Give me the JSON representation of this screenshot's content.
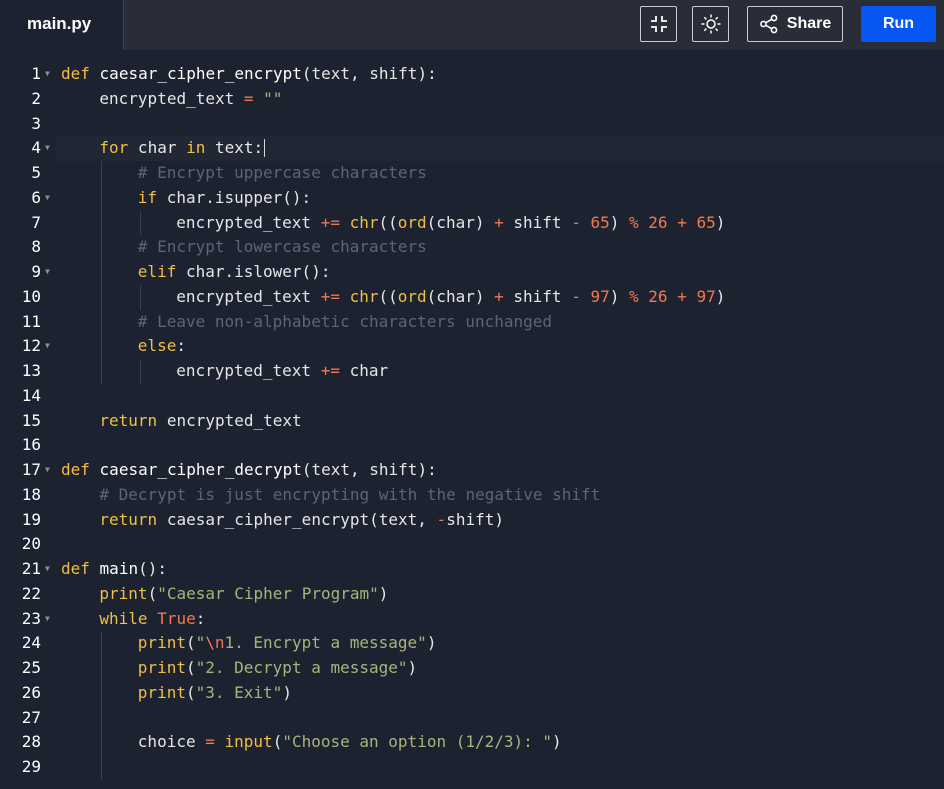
{
  "tab": {
    "filename": "main.py"
  },
  "toolbar": {
    "share_label": "Share",
    "run_label": "Run",
    "accent_color": "#0556f3",
    "buttons": [
      "compress-icon",
      "theme-sun-icon",
      "share-icon"
    ]
  },
  "editor": {
    "active_line": 4,
    "lines": [
      {
        "n": "1",
        "fold": true,
        "indent": 0,
        "tokens": [
          [
            "kw",
            "def"
          ],
          [
            "p",
            " "
          ],
          [
            "fn",
            "caesar_cipher_encrypt"
          ],
          [
            "p",
            "(text, shift):"
          ]
        ]
      },
      {
        "n": "2",
        "fold": false,
        "indent": 1,
        "tokens": [
          [
            "p",
            "encrypted_text "
          ],
          [
            "op",
            "="
          ],
          [
            "p",
            " "
          ],
          [
            "str",
            "\"\""
          ]
        ]
      },
      {
        "n": "3",
        "fold": false,
        "indent": 0,
        "tokens": []
      },
      {
        "n": "4",
        "fold": true,
        "indent": 1,
        "tokens": [
          [
            "kw",
            "for"
          ],
          [
            "p",
            " char "
          ],
          [
            "kw",
            "in"
          ],
          [
            "p",
            " text:"
          ]
        ]
      },
      {
        "n": "5",
        "fold": false,
        "indent": 2,
        "tokens": [
          [
            "cm",
            "# Encrypt uppercase characters"
          ]
        ]
      },
      {
        "n": "6",
        "fold": true,
        "indent": 2,
        "tokens": [
          [
            "kw",
            "if"
          ],
          [
            "p",
            " char.isupper():"
          ]
        ]
      },
      {
        "n": "7",
        "fold": false,
        "indent": 3,
        "tokens": [
          [
            "p",
            "encrypted_text "
          ],
          [
            "op",
            "+="
          ],
          [
            "p",
            " "
          ],
          [
            "bi",
            "chr"
          ],
          [
            "p",
            "(("
          ],
          [
            "bi",
            "ord"
          ],
          [
            "p",
            "(char) "
          ],
          [
            "op",
            "+"
          ],
          [
            "p",
            " shift "
          ],
          [
            "op",
            "-"
          ],
          [
            "p",
            " "
          ],
          [
            "num",
            "65"
          ],
          [
            "p",
            ") "
          ],
          [
            "op",
            "%"
          ],
          [
            "p",
            " "
          ],
          [
            "num",
            "26"
          ],
          [
            "p",
            " "
          ],
          [
            "op",
            "+"
          ],
          [
            "p",
            " "
          ],
          [
            "num",
            "65"
          ],
          [
            "p",
            ")"
          ]
        ]
      },
      {
        "n": "8",
        "fold": false,
        "indent": 2,
        "tokens": [
          [
            "cm",
            "# Encrypt lowercase characters"
          ]
        ]
      },
      {
        "n": "9",
        "fold": true,
        "indent": 2,
        "tokens": [
          [
            "kw",
            "elif"
          ],
          [
            "p",
            " char.islower():"
          ]
        ]
      },
      {
        "n": "10",
        "fold": false,
        "indent": 3,
        "tokens": [
          [
            "p",
            "encrypted_text "
          ],
          [
            "op",
            "+="
          ],
          [
            "p",
            " "
          ],
          [
            "bi",
            "chr"
          ],
          [
            "p",
            "(("
          ],
          [
            "bi",
            "ord"
          ],
          [
            "p",
            "(char) "
          ],
          [
            "op",
            "+"
          ],
          [
            "p",
            " shift "
          ],
          [
            "op",
            "-"
          ],
          [
            "p",
            " "
          ],
          [
            "num",
            "97"
          ],
          [
            "p",
            ") "
          ],
          [
            "op",
            "%"
          ],
          [
            "p",
            " "
          ],
          [
            "num",
            "26"
          ],
          [
            "p",
            " "
          ],
          [
            "op",
            "+"
          ],
          [
            "p",
            " "
          ],
          [
            "num",
            "97"
          ],
          [
            "p",
            ")"
          ]
        ]
      },
      {
        "n": "11",
        "fold": false,
        "indent": 2,
        "tokens": [
          [
            "cm",
            "# Leave non-alphabetic characters unchanged"
          ]
        ]
      },
      {
        "n": "12",
        "fold": true,
        "indent": 2,
        "tokens": [
          [
            "kw",
            "else"
          ],
          [
            "p",
            ":"
          ]
        ]
      },
      {
        "n": "13",
        "fold": false,
        "indent": 3,
        "tokens": [
          [
            "p",
            "encrypted_text "
          ],
          [
            "op",
            "+="
          ],
          [
            "p",
            " char"
          ]
        ]
      },
      {
        "n": "14",
        "fold": false,
        "indent": 0,
        "tokens": []
      },
      {
        "n": "15",
        "fold": false,
        "indent": 1,
        "tokens": [
          [
            "kw",
            "return"
          ],
          [
            "p",
            " encrypted_text"
          ]
        ]
      },
      {
        "n": "16",
        "fold": false,
        "indent": 0,
        "tokens": []
      },
      {
        "n": "17",
        "fold": true,
        "indent": 0,
        "tokens": [
          [
            "kw",
            "def"
          ],
          [
            "p",
            " "
          ],
          [
            "fn",
            "caesar_cipher_decrypt"
          ],
          [
            "p",
            "(text, shift):"
          ]
        ]
      },
      {
        "n": "18",
        "fold": false,
        "indent": 1,
        "tokens": [
          [
            "cm",
            "# Decrypt is just encrypting with the negative shift"
          ]
        ]
      },
      {
        "n": "19",
        "fold": false,
        "indent": 1,
        "tokens": [
          [
            "kw",
            "return"
          ],
          [
            "p",
            " caesar_cipher_encrypt(text, "
          ],
          [
            "op",
            "-"
          ],
          [
            "p",
            "shift)"
          ]
        ]
      },
      {
        "n": "20",
        "fold": false,
        "indent": 0,
        "tokens": []
      },
      {
        "n": "21",
        "fold": true,
        "indent": 0,
        "tokens": [
          [
            "kw",
            "def"
          ],
          [
            "p",
            " "
          ],
          [
            "fn",
            "main"
          ],
          [
            "p",
            "():"
          ]
        ]
      },
      {
        "n": "22",
        "fold": false,
        "indent": 1,
        "tokens": [
          [
            "bi",
            "print"
          ],
          [
            "p",
            "("
          ],
          [
            "str",
            "\"Caesar Cipher Program\""
          ],
          [
            "p",
            ")"
          ]
        ]
      },
      {
        "n": "23",
        "fold": true,
        "indent": 1,
        "tokens": [
          [
            "kw",
            "while"
          ],
          [
            "p",
            " "
          ],
          [
            "num",
            "True"
          ],
          [
            "p",
            ":"
          ]
        ]
      },
      {
        "n": "24",
        "fold": false,
        "indent": 2,
        "tokens": [
          [
            "bi",
            "print"
          ],
          [
            "p",
            "("
          ],
          [
            "str",
            "\""
          ],
          [
            "esc",
            "\\n"
          ],
          [
            "str",
            "1. Encrypt a message\""
          ],
          [
            "p",
            ")"
          ]
        ]
      },
      {
        "n": "25",
        "fold": false,
        "indent": 2,
        "tokens": [
          [
            "bi",
            "print"
          ],
          [
            "p",
            "("
          ],
          [
            "str",
            "\"2. Decrypt a message\""
          ],
          [
            "p",
            ")"
          ]
        ]
      },
      {
        "n": "26",
        "fold": false,
        "indent": 2,
        "tokens": [
          [
            "bi",
            "print"
          ],
          [
            "p",
            "("
          ],
          [
            "str",
            "\"3. Exit\""
          ],
          [
            "p",
            ")"
          ]
        ]
      },
      {
        "n": "27",
        "fold": false,
        "indent": 0,
        "tokens": []
      },
      {
        "n": "28",
        "fold": false,
        "indent": 2,
        "tokens": [
          [
            "p",
            "choice "
          ],
          [
            "op",
            "="
          ],
          [
            "p",
            " "
          ],
          [
            "bi",
            "input"
          ],
          [
            "p",
            "("
          ],
          [
            "str",
            "\"Choose an option (1/2/3): \""
          ],
          [
            "p",
            ")"
          ]
        ]
      },
      {
        "n": "29",
        "fold": false,
        "indent": 0,
        "tokens": []
      }
    ]
  }
}
